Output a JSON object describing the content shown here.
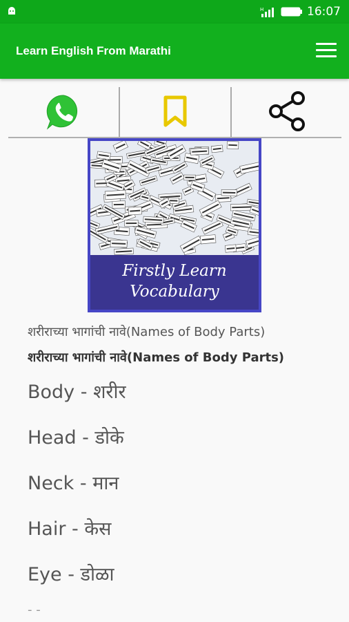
{
  "status_bar": {
    "time": "16:07",
    "icons": [
      "android-icon",
      "signal-icon",
      "battery-icon"
    ]
  },
  "app_bar": {
    "title": "Learn English From Marathi",
    "menu_icon": "hamburger-menu-icon"
  },
  "actions": [
    {
      "name": "whatsapp-share",
      "icon": "whatsapp-icon"
    },
    {
      "name": "bookmark",
      "icon": "bookmark-icon"
    },
    {
      "name": "share",
      "icon": "share-icon"
    }
  ],
  "banner": {
    "line1": "Firstly Learn",
    "line2": "Vocabulary"
  },
  "content": {
    "heading_regular": "शरीराच्या भागांची नावे(Names of Body Parts)",
    "heading_bold": "शरीराच्या भागांची नावे(Names of Body Parts)",
    "words": [
      "Body - शरीर",
      "Head - डोके",
      "Neck - मान",
      "Hair - केस",
      "Eye - डोळा"
    ],
    "partial_next": "- -"
  },
  "colors": {
    "status_bar": "#0ea81a",
    "app_bar": "#12b01e",
    "banner_border": "#4646c6",
    "banner_caption_bg": "#3a3590",
    "bookmark": "#e8c800",
    "whatsapp": "#2fc236"
  }
}
